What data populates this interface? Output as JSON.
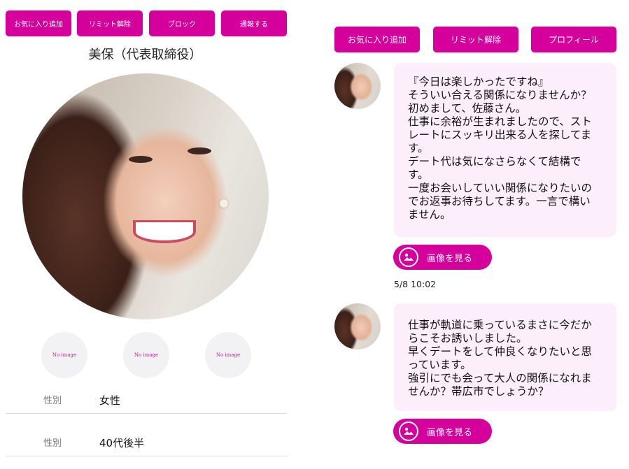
{
  "left_panel": {
    "buttons": [
      "お気に入り追加",
      "リミット解除",
      "ブロック",
      "通報する"
    ],
    "title": "美保（代表取締役）",
    "thumbnails": [
      "No image",
      "No image",
      "No image"
    ],
    "rows": [
      {
        "label": "性別",
        "value": "女性"
      },
      {
        "label": "性別",
        "value": "40代後半"
      }
    ]
  },
  "right_panel": {
    "buttons": [
      "お気に入り追加",
      "リミット解除",
      "プロフィール"
    ],
    "messages": [
      {
        "lines": [
          "『今日は楽しかったですね』",
          "そういい合える関係になりませんか？",
          "初めまして、佐藤さん。",
          "仕事に余裕が生まれましたので、スト",
          "レートにスッキリ出来る人を探してま",
          "す。",
          "デート代は気になさらなくて結構で",
          "す。",
          "一度お会いしていい関係になりたいの",
          "でお返事お待ちしてます。一言で構い",
          "ません。"
        ],
        "image_button": "画像を見る",
        "timestamp": "5/8 10:02"
      },
      {
        "lines": [
          "仕事が軌道に乗っているまさに今だか",
          "らこそお誘いしました。",
          "早くデートをして仲良くなりたいと思",
          "っています。",
          "強引にでも会って大人の関係になれま",
          "せんか？帯広市でしょうか？"
        ],
        "image_button": "画像を見る"
      }
    ]
  },
  "colors": {
    "accent": "#d5009b",
    "bubble": "#fdeefc"
  }
}
